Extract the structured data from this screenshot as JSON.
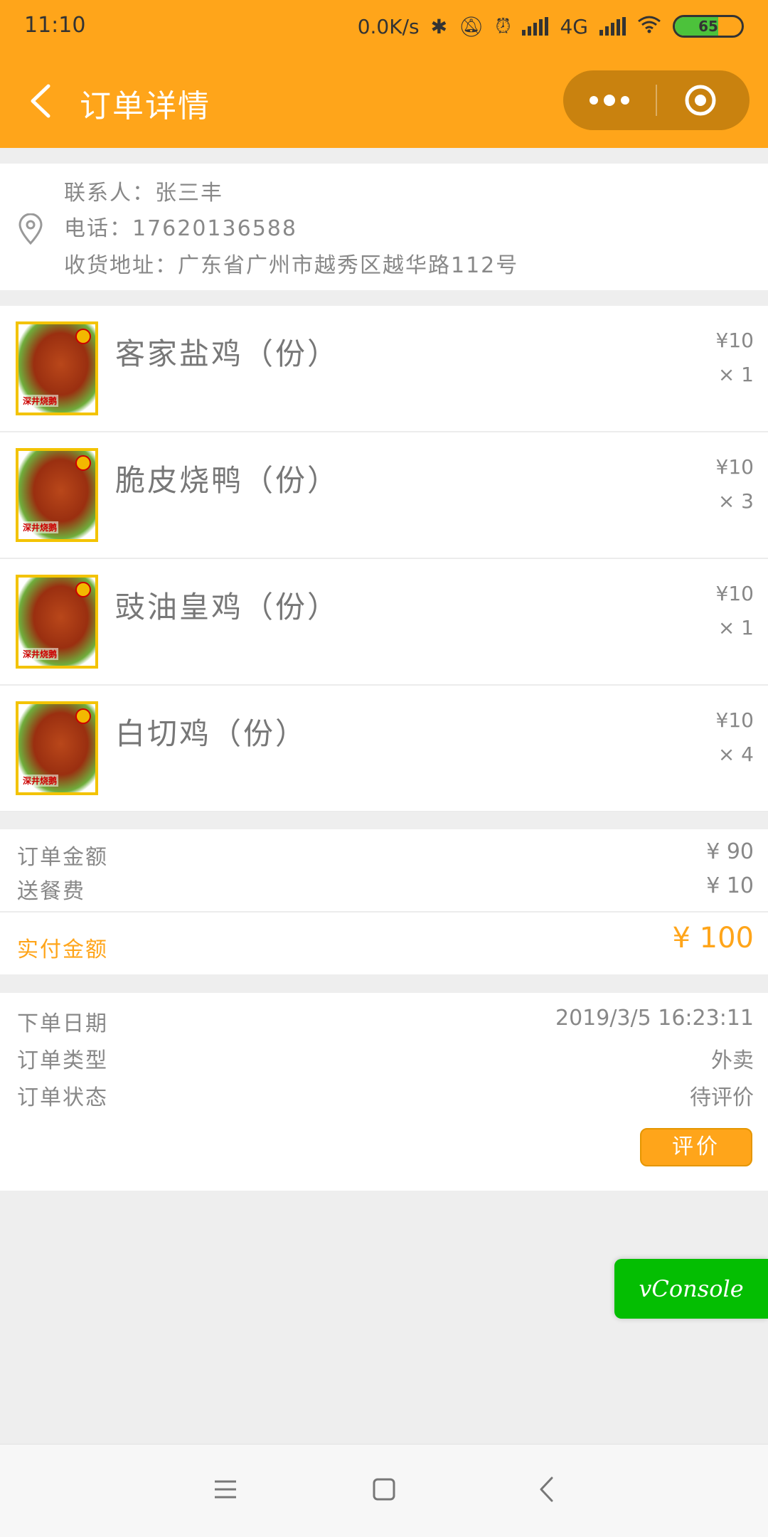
{
  "status_bar": {
    "time": "11:10",
    "net_speed": "0.0K/s",
    "network": "4G",
    "battery": "65"
  },
  "header": {
    "title": "订单详情"
  },
  "address": {
    "contact": "联系人：张三丰",
    "phone": "电话：17620136588",
    "address": "收货地址：广东省广州市越秀区越华路112号"
  },
  "items": [
    {
      "name": "客家盐鸡（份）",
      "price": "¥10",
      "qty": "× 1"
    },
    {
      "name": "脆皮烧鸭（份）",
      "price": "¥10",
      "qty": "× 3"
    },
    {
      "name": "豉油皇鸡（份）",
      "price": "¥10",
      "qty": "× 1"
    },
    {
      "name": "白切鸡（份）",
      "price": "¥10",
      "qty": "× 4"
    }
  ],
  "thumb_text": "深井烧鹅",
  "money": {
    "order_amount_label": "订单金额",
    "order_amount": "¥ 90",
    "delivery_label": "送餐费",
    "delivery": "¥ 10",
    "paid_label": "实付金额",
    "paid": "¥ 100"
  },
  "order_info": {
    "date_label": "下单日期",
    "date": "2019/3/5 16:23:11",
    "type_label": "订单类型",
    "type": "外卖",
    "status_label": "订单状态",
    "status": "待评价",
    "rate_button": "评价"
  },
  "vconsole": "vConsole",
  "colors": {
    "accent": "#ffa51a",
    "vconsole": "#04be02"
  }
}
